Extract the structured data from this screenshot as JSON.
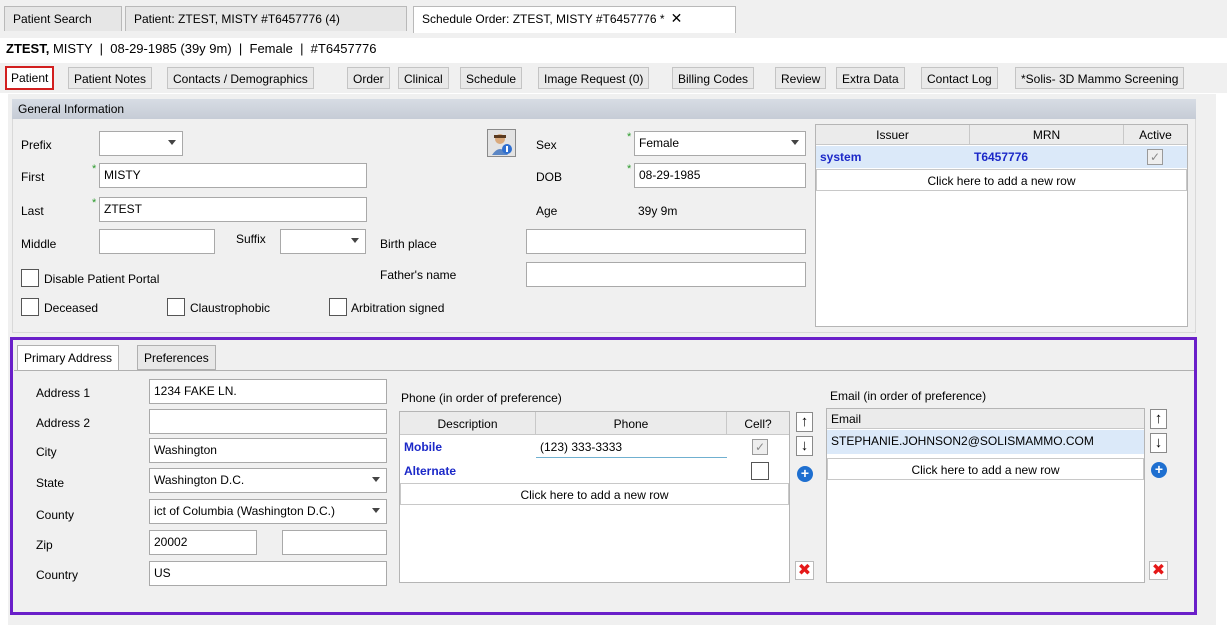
{
  "doc_tabs": [
    {
      "label": "Patient Search"
    },
    {
      "label": "Patient: ZTEST, MISTY #T6457776 (4)"
    },
    {
      "label": "Schedule Order: ZTEST, MISTY #T6457776 *"
    }
  ],
  "header": {
    "last_name": "ZTEST,",
    "rest": "MISTY  |  08-29-1985 (39y 9m)  |  Female  |  #T6457776"
  },
  "sub_tabs": [
    {
      "label": "Patient"
    },
    {
      "label": "Patient Notes"
    },
    {
      "label": "Contacts / Demographics"
    },
    {
      "label": "Order"
    },
    {
      "label": "Clinical"
    },
    {
      "label": "Schedule"
    },
    {
      "label": "Image Request (0)"
    },
    {
      "label": "Billing Codes"
    },
    {
      "label": "Review"
    },
    {
      "label": "Extra Data"
    },
    {
      "label": "Contact Log"
    },
    {
      "label": "*Solis- 3D Mammo Screening"
    }
  ],
  "general": {
    "title": "General Information",
    "prefix_label": "Prefix",
    "prefix_value": "",
    "first_label": "First",
    "first_value": "MISTY",
    "last_label": "Last",
    "last_value": "ZTEST",
    "middle_label": "Middle",
    "middle_value": "",
    "suffix_label": "Suffix",
    "suffix_value": "",
    "sex_label": "Sex",
    "sex_value": "Female",
    "dob_label": "DOB",
    "dob_value": "08-29-1985",
    "age_label": "Age",
    "age_value": "39y 9m",
    "birthplace_label": "Birth place",
    "birthplace_value": "",
    "father_label": "Father's name",
    "father_value": "",
    "disable_portal_label": "Disable Patient Portal",
    "deceased_label": "Deceased",
    "claustrophobic_label": "Claustrophobic",
    "arbitration_label": "Arbitration signed"
  },
  "mrn_grid": {
    "headers": [
      "Issuer",
      "MRN",
      "Active"
    ],
    "rows": [
      {
        "issuer": "system",
        "mrn": "T6457776",
        "active": "✓"
      }
    ],
    "add_row": "Click here to add a new row"
  },
  "address_tabs": [
    {
      "label": "Primary Address"
    },
    {
      "label": "Preferences"
    }
  ],
  "address": {
    "address1_label": "Address 1",
    "address1_value": "1234 FAKE LN.",
    "address2_label": "Address 2",
    "address2_value": "",
    "city_label": "City",
    "city_value": "Washington",
    "state_label": "State",
    "state_value": "Washington D.C.",
    "county_label": "County",
    "county_value": "ict of Columbia (Washington D.C.)",
    "zip_label": "Zip",
    "zip_value": "20002",
    "zip_ext_value": "",
    "country_label": "Country",
    "country_value": "US"
  },
  "phone": {
    "title": "Phone (in order of preference)",
    "headers": [
      "Description",
      "Phone",
      "Cell?"
    ],
    "rows": [
      {
        "desc": "Mobile",
        "phone": "(123) 333-3333",
        "cell": "✓"
      },
      {
        "desc": "Alternate",
        "phone": "",
        "cell": ""
      }
    ],
    "add_row": "Click here to add a new row"
  },
  "email": {
    "title": "Email (in order of preference)",
    "header": "Email",
    "rows": [
      {
        "email": "STEPHANIE.JOHNSON2@SOLISMAMMO.COM"
      }
    ],
    "add_row": "Click here to add a new row"
  },
  "icons": {
    "up": "↑",
    "down": "↓",
    "plus": "+",
    "delete": "✖",
    "close": "✕",
    "dropdown": "chevron-down"
  },
  "colors": {
    "active_tab_outline": "#d21f1f",
    "address_frame": "#6a1fc9",
    "link_blue": "#1b28c8",
    "required_marker": "#2a9a2a"
  }
}
